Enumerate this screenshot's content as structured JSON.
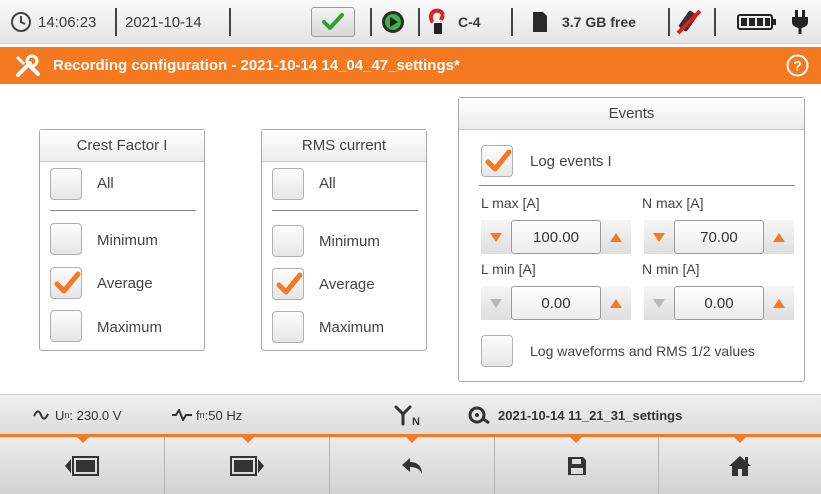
{
  "status": {
    "time": "14:06:23",
    "date": "2021-10-14",
    "clamp_label": "C-4",
    "memory_free": "3.7 GB free"
  },
  "titlebar": {
    "title": "Recording configuration - 2021-10-14 14_04_47_settings*",
    "help_icon": "help-icon"
  },
  "crest_panel": {
    "title": "Crest Factor I",
    "all_label": "All",
    "items": [
      {
        "label": "Minimum",
        "checked": false
      },
      {
        "label": "Average",
        "checked": true
      },
      {
        "label": "Maximum",
        "checked": false
      }
    ]
  },
  "rms_panel": {
    "title": "RMS current",
    "all_label": "All",
    "items": [
      {
        "label": "Minimum",
        "checked": false
      },
      {
        "label": "Average",
        "checked": true
      },
      {
        "label": "Maximum",
        "checked": false
      }
    ]
  },
  "events_panel": {
    "title": "Events",
    "log_events_label": "Log events I",
    "log_events_checked": true,
    "l_max_label": "L max [A]",
    "l_max_value": "100.00",
    "n_max_label": "N max [A]",
    "n_max_value": "70.00",
    "l_min_label": "L min [A]",
    "l_min_value": "0.00",
    "n_min_label": "N min [A]",
    "n_min_value": "0.00",
    "log_waveforms_label": "Log waveforms and RMS 1/2 values",
    "log_waveforms_checked": false
  },
  "infobar": {
    "un_prefix": "U",
    "un_sub": "n",
    "un_value": ": 230.0 V",
    "fn_prefix": "f",
    "fn_sub": "n",
    "fn_value": ":50 Hz",
    "settings_file": "2021-10-14 11_21_31_settings"
  },
  "colors": {
    "accent": "#f47920",
    "check_green": "#2e9e2e"
  }
}
